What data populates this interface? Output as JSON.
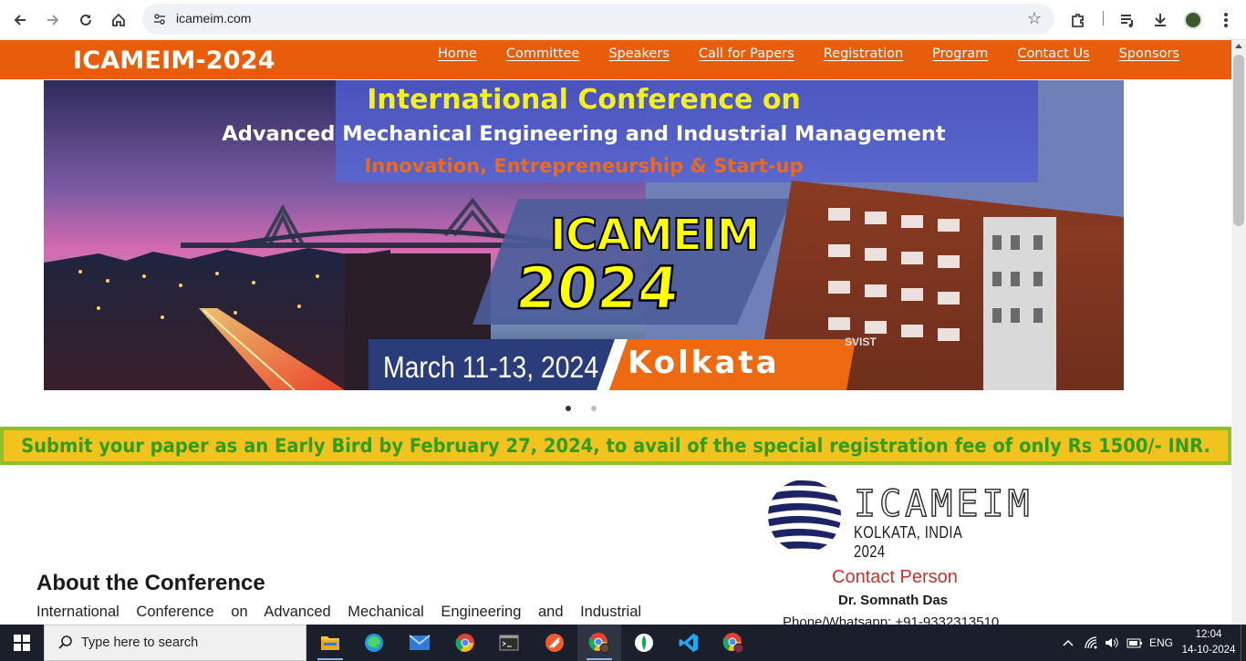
{
  "browser": {
    "url": "icameim.com",
    "icons": [
      "back-icon",
      "forward-icon",
      "reload-icon",
      "home-icon",
      "site-settings-icon",
      "bookmark-star-icon",
      "extensions-icon",
      "media-controls-icon",
      "downloads-icon",
      "profile-avatar",
      "menu-kebab-icon"
    ]
  },
  "header": {
    "brand": "ICAMEIM-2024",
    "nav": [
      "Home",
      "Committee",
      "Speakers",
      "Call for Papers",
      "Registration",
      "Program",
      "Contact Us",
      "Sponsors"
    ]
  },
  "banner": {
    "title_line1": "International Conference on",
    "title_line2": "Advanced Mechanical Engineering and Industrial Management",
    "title_line3": "Innovation, Entrepreneurship & Start-up",
    "acronym": "ICAMEIM",
    "year": "2024",
    "dates": "March 11-13, 2024",
    "city": "Kolkata",
    "building_sign": "SVIST",
    "slides_total": 2,
    "active_slide": 1
  },
  "announcement": "Submit your paper as an Early Bird by February 27, 2024, to avail of the special registration fee of only Rs 1500/- INR.",
  "about": {
    "heading": "About the Conference",
    "text": "International Conference on Advanced Mechanical Engineering and Industrial"
  },
  "logo": {
    "acronym": "ICAMEIM",
    "subtitle": "KOLKATA, INDIA 2024"
  },
  "contact": {
    "heading": "Contact Person",
    "name": "Dr. Somnath Das",
    "phone": "Phone/Whatsapp: +91-9332313510"
  },
  "taskbar": {
    "search_placeholder": "Type here to search",
    "apps": [
      "file-explorer-icon",
      "edge-icon",
      "mail-icon",
      "chrome-icon",
      "terminal-icon",
      "app-icon",
      "chrome-profile-icon",
      "mongodb-compass-icon",
      "vscode-icon",
      "chrome-alt-icon"
    ],
    "language": "ENG",
    "time": "12:04",
    "date": "14-10-2024"
  },
  "colors": {
    "header_orange": "#e85d0c",
    "strip_green": "#8fbf2a",
    "strip_yellow": "#f2c31f",
    "announce_text": "#2e9e1b",
    "contact_red": "#c7322e"
  }
}
